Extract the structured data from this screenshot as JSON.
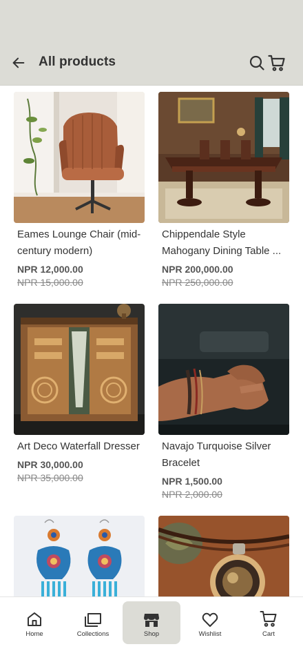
{
  "header": {
    "title": "All products",
    "back_icon": "arrow-left-icon",
    "search_icon": "search-icon",
    "cart_icon": "cart-icon"
  },
  "products": [
    {
      "name": "Eames Lounge Chair (mid-century modern)",
      "price": "NPR 12,000.00",
      "old_price": "NPR 15,000.00"
    },
    {
      "name": "Chippendale Style Mahogany Dining Table ...",
      "price": "NPR 200,000.00",
      "old_price": "NPR 250,000.00"
    },
    {
      "name": "Art Deco Waterfall Dresser",
      "price": "NPR 30,000.00",
      "old_price": "NPR 35,000.00"
    },
    {
      "name": "Navajo Turquoise Silver Bracelet",
      "price": "NPR 1,500.00",
      "old_price": "NPR 2,000.00"
    },
    {
      "name": "",
      "price": "",
      "old_price": ""
    },
    {
      "name": "",
      "price": "",
      "old_price": ""
    }
  ],
  "nav": {
    "items": [
      {
        "label": "Home",
        "icon": "home-icon"
      },
      {
        "label": "Collections",
        "icon": "collections-icon"
      },
      {
        "label": "Shop",
        "icon": "shop-icon",
        "active": true
      },
      {
        "label": "Wishlist",
        "icon": "heart-icon"
      },
      {
        "label": "Cart",
        "icon": "cart-icon"
      }
    ]
  },
  "colors": {
    "app_bar": "#dcdcd6",
    "active_nav": "#dcdcd6",
    "text": "#333333"
  }
}
